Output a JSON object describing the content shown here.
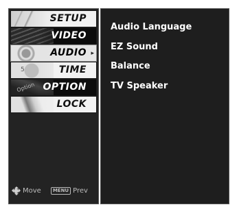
{
  "menu": {
    "items": [
      {
        "label": "SETUP",
        "icon": "setup-thumbnail",
        "style": "light"
      },
      {
        "label": "VIDEO",
        "icon": "video-thumbnail",
        "style": "dark"
      },
      {
        "label": "AUDIO",
        "icon": "audio-thumbnail",
        "style": "selected"
      },
      {
        "label": "TIME",
        "icon": "time-thumbnail",
        "style": "light"
      },
      {
        "label": "OPTION",
        "icon": "option-thumbnail",
        "style": "dark"
      },
      {
        "label": "LOCK",
        "icon": "lock-thumbnail",
        "style": "light"
      }
    ],
    "selected_arrow": "▸",
    "thumb_text_time": "5",
    "thumb_text_option": "Option"
  },
  "footer": {
    "move_label": "Move",
    "menu_key_label": "MENU",
    "prev_label": "Prev"
  },
  "submenu": {
    "items": [
      "Audio Language",
      "EZ Sound",
      "Balance",
      "TV Speaker"
    ]
  },
  "colors": {
    "panel_background": "#232323",
    "submenu_background": "#1e1e1e",
    "text_white": "#ffffff"
  }
}
